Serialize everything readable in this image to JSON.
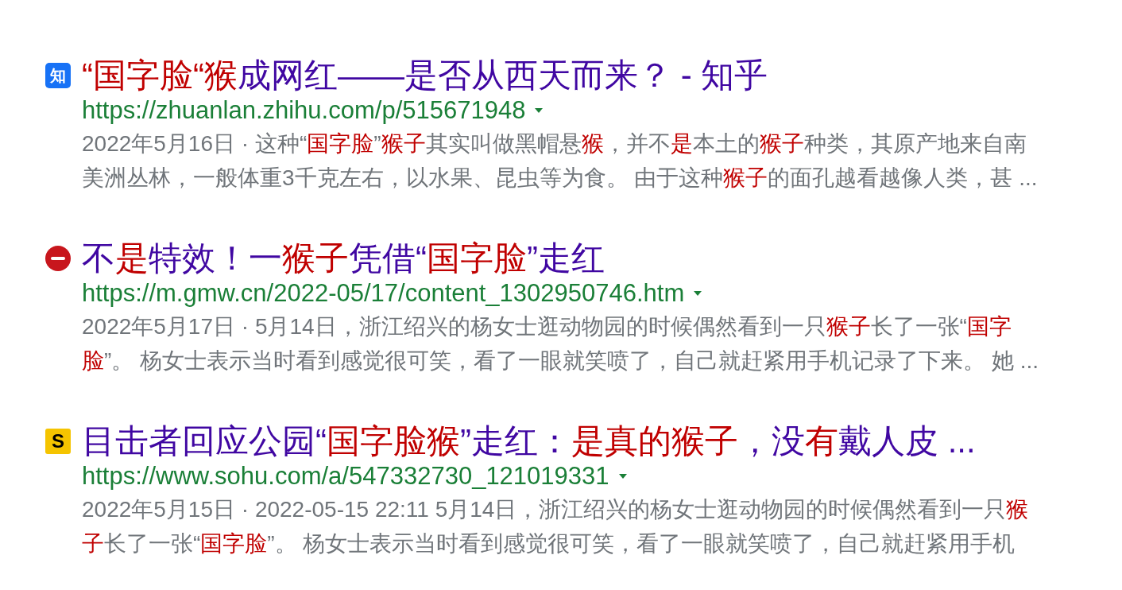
{
  "results": [
    {
      "favicon": {
        "kind": "zhihu",
        "label": "知"
      },
      "title": [
        {
          "text": "“国字脸“",
          "highlight": true
        },
        {
          "text": "猴",
          "highlight": true
        },
        {
          "text": "成网红——是否从西天而来？ - 知乎",
          "highlight": false
        }
      ],
      "url": "https://zhuanlan.zhihu.com/p/515671948",
      "snippet": [
        {
          "text": "2022年5月16日 · 这种“",
          "highlight": false
        },
        {
          "text": "国字脸",
          "highlight": true
        },
        {
          "text": "”",
          "highlight": false
        },
        {
          "text": "猴子",
          "highlight": true
        },
        {
          "text": "其实叫做黑帽悬",
          "highlight": false
        },
        {
          "text": "猴",
          "highlight": true
        },
        {
          "text": "，并不",
          "highlight": false
        },
        {
          "text": "是",
          "highlight": true
        },
        {
          "text": "本土的",
          "highlight": false
        },
        {
          "text": "猴子",
          "highlight": true
        },
        {
          "text": "种类，其原产地来自南美洲丛林，一般体重3千克左右，以水果、昆虫等为食。 由于这种",
          "highlight": false
        },
        {
          "text": "猴子",
          "highlight": true
        },
        {
          "text": "的面孔越看越像人类，甚 ...",
          "highlight": false
        }
      ]
    },
    {
      "favicon": {
        "kind": "gmw"
      },
      "title": [
        {
          "text": "不",
          "highlight": false
        },
        {
          "text": "是",
          "highlight": true
        },
        {
          "text": "特效！一",
          "highlight": false
        },
        {
          "text": "猴子",
          "highlight": true
        },
        {
          "text": "凭借“",
          "highlight": false
        },
        {
          "text": "国字脸",
          "highlight": true
        },
        {
          "text": "”走红",
          "highlight": false
        }
      ],
      "url": "https://m.gmw.cn/2022-05/17/content_1302950746.htm",
      "snippet": [
        {
          "text": "2022年5月17日 · 5月14日，浙江绍兴的杨女士逛动物园的时候偶然看到一只",
          "highlight": false
        },
        {
          "text": "猴子",
          "highlight": true
        },
        {
          "text": "长了一张“",
          "highlight": false
        },
        {
          "text": "国字脸",
          "highlight": true
        },
        {
          "text": "”。 杨女士表示当时看到感觉很可笑，看了一眼就笑喷了，自己就赶紧用手机记录了下来。 她 ...",
          "highlight": false
        }
      ]
    },
    {
      "favicon": {
        "kind": "sohu",
        "label": "S"
      },
      "title": [
        {
          "text": "目击者回应公园“",
          "highlight": false
        },
        {
          "text": "国字脸猴",
          "highlight": true
        },
        {
          "text": "”走红：",
          "highlight": false
        },
        {
          "text": "是真的猴子",
          "highlight": true
        },
        {
          "text": "，没",
          "highlight": false
        },
        {
          "text": "有",
          "highlight": true
        },
        {
          "text": "戴人皮 ...",
          "highlight": false
        }
      ],
      "url": "https://www.sohu.com/a/547332730_121019331",
      "snippet": [
        {
          "text": "2022年5月15日 · 2022-05-15 22:11 5月14日，浙江绍兴的杨女士逛动物园的时候偶然看到一只",
          "highlight": false
        },
        {
          "text": "猴子",
          "highlight": true
        },
        {
          "text": "长了一张“",
          "highlight": false
        },
        {
          "text": "国字脸",
          "highlight": true
        },
        {
          "text": "”。 杨女士表示当时看到感觉很可笑，看了一眼就笑喷了，自己就赶紧用手机",
          "highlight": false
        }
      ]
    }
  ]
}
